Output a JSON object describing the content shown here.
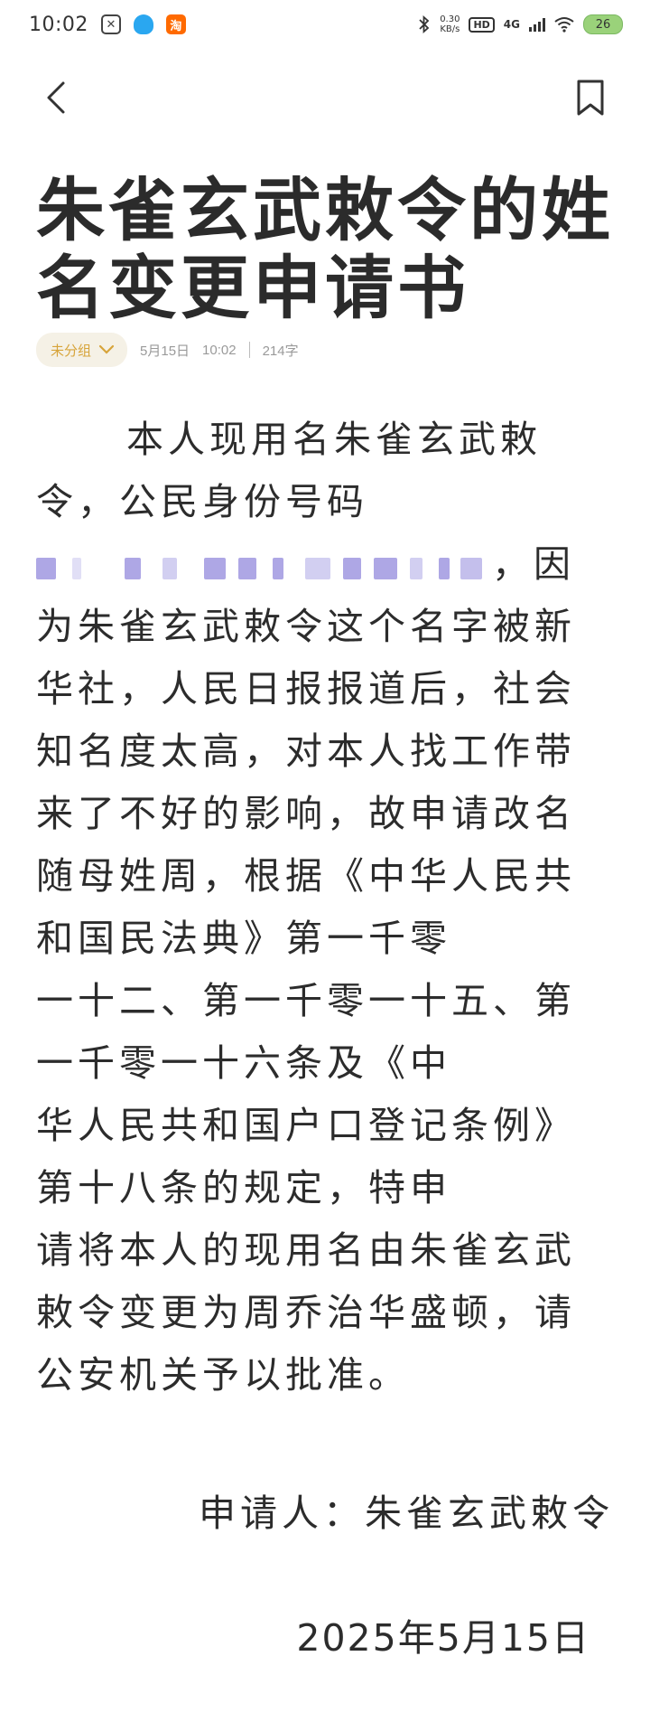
{
  "status_bar": {
    "time": "10:02",
    "speed_value": "0.30",
    "speed_unit": "KB/s",
    "hd": "HD",
    "network": "4G",
    "battery": "26"
  },
  "article": {
    "title_line1": "朱雀玄武敕令的姓",
    "title_line2": "名变更申请书",
    "group": "未分组",
    "date": "5月15日",
    "time": "10:02",
    "word_count": "214字",
    "body_lines": [
      "本人现用名朱雀玄武敕",
      "令，公民身份号码",
      "，因",
      "为朱雀玄武敕令这个名字被新",
      "华社，人民日报报道后，社会",
      "知名度太高，对本人找工作带",
      "来了不好的影响，故申请改名",
      "随母姓周，根据《中华人民共",
      "和国民法典》第一千零",
      "一十二、第一千零一十五、第",
      "一千零一十六条及《中",
      "华人民共和国户口登记条例》",
      "第十八条的规定，特申",
      "请将本人的现用名由朱雀玄武",
      "敕令变更为周乔治华盛顿，请",
      "公安机关予以批准。"
    ],
    "signature": "申请人：朱雀玄武敕令",
    "sign_date": "2025年5月15日"
  }
}
